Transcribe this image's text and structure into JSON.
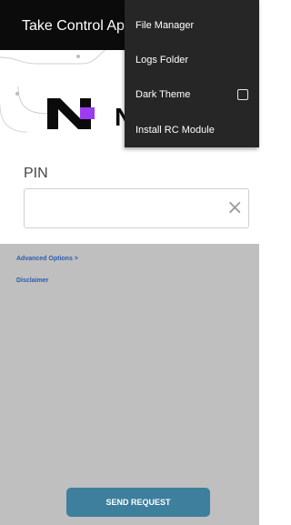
{
  "app_bar": {
    "title": "Take Control Ap"
  },
  "logo": {
    "brand_letter": "N",
    "accent": "#8a2be2"
  },
  "pin": {
    "label": "PIN",
    "value": "",
    "clear_glyph": "×"
  },
  "links": {
    "advanced": "Advanced Options  >",
    "disclaimer": "Disclaimer"
  },
  "actions": {
    "send": "SEND REQUEST"
  },
  "menu": {
    "items": [
      {
        "label": "File Manager"
      },
      {
        "label": "Logs Folder"
      },
      {
        "label": "Dark Theme",
        "checkbox_checked": false
      },
      {
        "label": "Install RC Module"
      }
    ]
  },
  "colors": {
    "app_bar_bg": "#0b0b0b",
    "menu_bg": "#262626",
    "overlay": "#bfbfbf",
    "button_bg": "#3d7f9c",
    "link": "#2b5cae"
  }
}
